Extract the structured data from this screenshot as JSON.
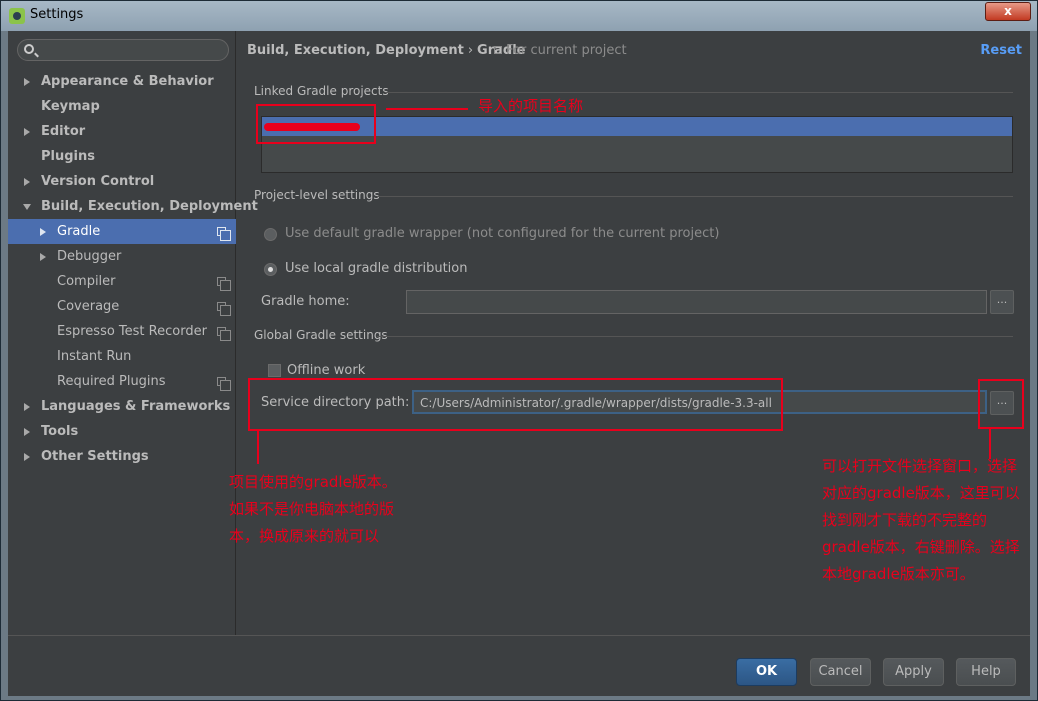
{
  "window": {
    "title": "Settings",
    "close_label": "x"
  },
  "search": {
    "placeholder": "",
    "value": ""
  },
  "sidebar": {
    "items": [
      {
        "label": "Appearance & Behavior"
      },
      {
        "label": "Keymap"
      },
      {
        "label": "Editor"
      },
      {
        "label": "Plugins"
      },
      {
        "label": "Version Control"
      },
      {
        "label": "Build, Execution, Deployment"
      },
      {
        "label": "Gradle"
      },
      {
        "label": "Debugger"
      },
      {
        "label": "Compiler"
      },
      {
        "label": "Coverage"
      },
      {
        "label": "Espresso Test Recorder"
      },
      {
        "label": "Instant Run"
      },
      {
        "label": "Required Plugins"
      },
      {
        "label": "Languages & Frameworks"
      },
      {
        "label": "Tools"
      },
      {
        "label": "Other Settings"
      }
    ]
  },
  "header": {
    "crumb_parent": "Build, Execution, Deployment",
    "crumb_sep": "›",
    "crumb_current": "Gradle",
    "for_project": "For current project",
    "reset": "Reset"
  },
  "linked": {
    "title": "Linked Gradle projects"
  },
  "project_level": {
    "title": "Project-level settings",
    "option_default": "Use default gradle wrapper (not configured for the current project)",
    "option_local": "Use local gradle distribution",
    "gradle_home_label": "Gradle home:",
    "gradle_home_value": "",
    "browse": "..."
  },
  "global": {
    "title": "Global Gradle settings",
    "offline": "Offline work",
    "service_label": "Service directory path:",
    "service_value": "C:/Users/Administrator/.gradle/wrapper/dists/gradle-3.3-all",
    "browse": "..."
  },
  "annotations": {
    "project_name": "导入的项目名称",
    "gradle_version": [
      "项目使用的gradle版本。",
      "如果不是你电脑本地的版",
      "本，换成原来的就可以"
    ],
    "file_chooser": [
      "可以打开文件选择窗口，选择",
      "对应的gradle版本，这里可以",
      "找到刚才下载的不完整的",
      "gradle版本，右键删除。选择",
      "本地gradle版本亦可。"
    ],
    "color": "#e8001c"
  },
  "buttons": {
    "ok": "OK",
    "cancel": "Cancel",
    "apply": "Apply",
    "help": "Help"
  }
}
